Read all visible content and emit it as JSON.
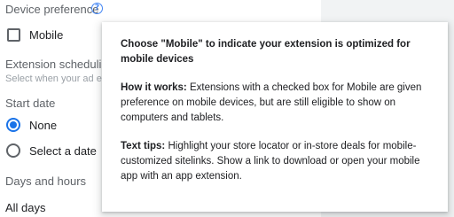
{
  "form": {
    "device_preference": {
      "label": "Device preference",
      "help_icon": "help-circle-icon",
      "mobile_checkbox": {
        "label": "Mobile",
        "checked": false
      }
    },
    "extension_scheduling": {
      "label": "Extension scheduling",
      "hint": "Select when your ad ext"
    },
    "start_date": {
      "label": "Start date",
      "options": [
        {
          "label": "None",
          "selected": true
        },
        {
          "label": "Select a date",
          "selected": false
        }
      ]
    },
    "days_and_hours": {
      "label": "Days and hours",
      "value": "All days"
    }
  },
  "tooltip": {
    "heading": "Choose \"Mobile\" to indicate your extension is optimized for mobile devices",
    "how_it_works_label": "How it works:",
    "how_it_works_text": " Extensions with a checked box for Mobile are given preference on mobile devices, but are still eligible to show on computers and tablets.",
    "text_tips_label": "Text tips:",
    "text_tips_text": " Highlight your store locator or in-store deals for mobile-customized sitelinks. Show a link to download or open your mobile app with an app extension."
  },
  "colors": {
    "accent": "#1a73e8",
    "help_icon": "#4285f4",
    "gutter": "#f1f3f4"
  }
}
